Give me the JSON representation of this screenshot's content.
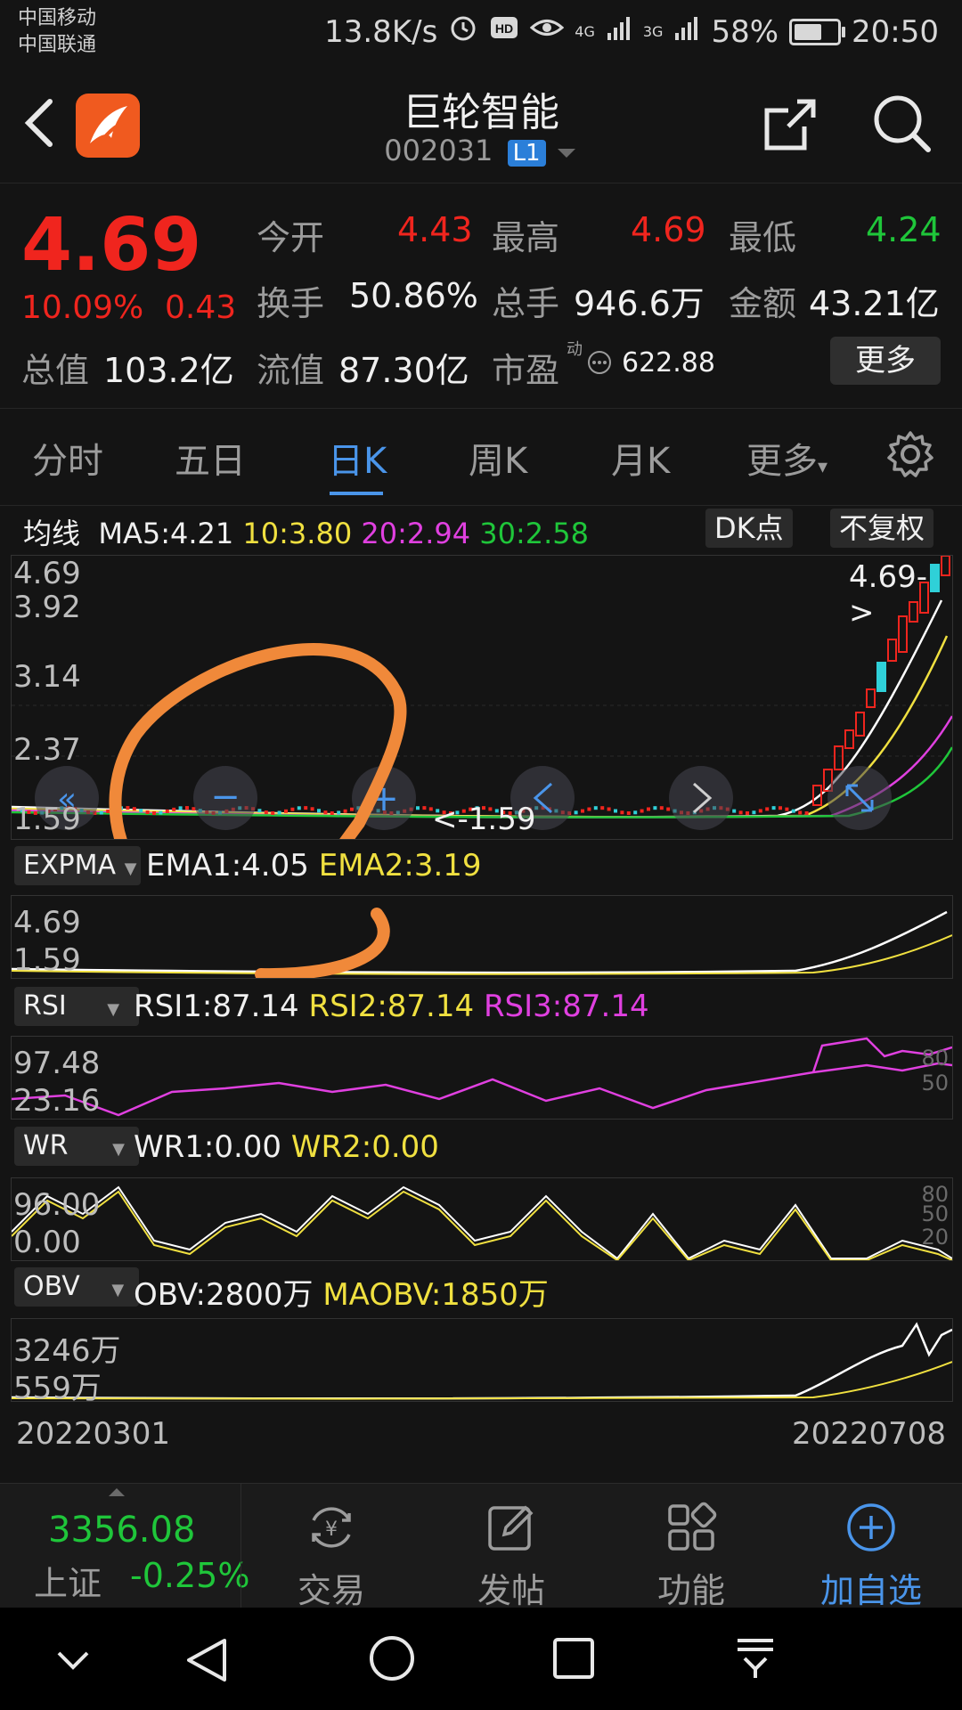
{
  "status_bar": {
    "carrier1": "中国移动",
    "carrier2": "中国联通",
    "speed": "13.8K/s",
    "signal_4g": "4G",
    "signal_3g": "3G",
    "battery": "58%",
    "time": "20:50"
  },
  "header": {
    "title": "巨轮智能",
    "code": "002031",
    "level": "L1"
  },
  "quote": {
    "price": "4.69",
    "change_pct": "10.09%",
    "change": "0.43",
    "open_label": "今开",
    "open": "4.43",
    "high_label": "最高",
    "high": "4.69",
    "low_label": "最低",
    "low": "4.24",
    "turnover_label": "换手",
    "turnover": "50.86%",
    "volume_label": "总手",
    "volume": "946.6万",
    "amount_label": "金额",
    "amount": "43.21亿",
    "mcap_label": "总值",
    "mcap": "103.2亿",
    "float_label": "流值",
    "float": "87.30亿",
    "pe_label": "市盈",
    "pe_sup": "动",
    "pe": "622.88",
    "more": "更多"
  },
  "tabs": [
    "分时",
    "五日",
    "日K",
    "周K",
    "月K",
    "更多"
  ],
  "ma_row": {
    "label": "均线",
    "ma5": "MA5:4.21",
    "ma10": "10:3.80",
    "ma20": "20:2.94",
    "ma30": "30:2.58",
    "dk": "DK点",
    "fq": "不复权"
  },
  "kline": {
    "axis": [
      "4.69",
      "3.92",
      "3.14",
      "2.37",
      "1.59"
    ],
    "max_marker": "4.69->",
    "min_marker": "<-1.59"
  },
  "expma": {
    "name": "EXPMA",
    "ema1": "EMA1:4.05",
    "ema2": "EMA2:3.19",
    "axis_top": "4.69",
    "axis_bottom": "1.59"
  },
  "rsi": {
    "name": "RSI",
    "rsi1": "RSI1:87.14",
    "rsi2": "RSI2:87.14",
    "rsi3": "RSI3:87.14",
    "axis_top": "97.48",
    "axis_bottom": "23.16",
    "level_80": "80",
    "level_50": "50"
  },
  "wr": {
    "name": "WR",
    "wr1": "WR1:0.00",
    "wr2": "WR2:0.00",
    "axis_top": "96.00",
    "axis_bottom": "0.00",
    "level_80": "80",
    "level_50": "50",
    "level_20": "20"
  },
  "obv": {
    "name": "OBV",
    "obv": "OBV:2800万",
    "maobv": "MAOBV:1850万",
    "axis_top": "3246万",
    "axis_bottom": "559万"
  },
  "dates": {
    "start": "20220301",
    "end": "20220708"
  },
  "bottom_nav": {
    "index_value": "3356.08",
    "index_name": "上证",
    "index_change": "-0.25%",
    "trade": "交易",
    "post": "发帖",
    "functions": "功能",
    "add": "加自选"
  }
}
